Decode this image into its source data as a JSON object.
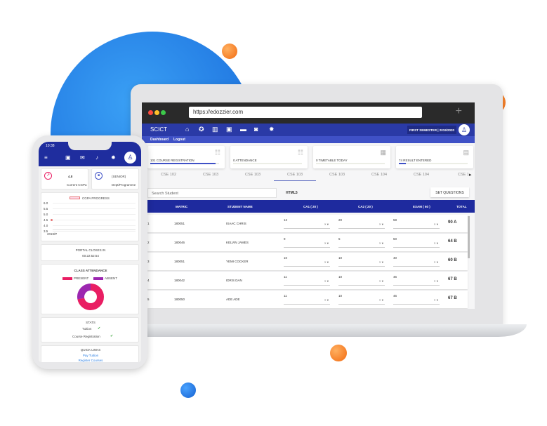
{
  "colors": {
    "primary": "#2a3aa6",
    "header": "#1e2a9e",
    "accent_orange": "#f26a10",
    "present": "#e91e63",
    "absent": "#9c27b0",
    "check": "#2e9e2e"
  },
  "laptop": {
    "browser": {
      "url": "https://edozzier.com"
    },
    "app": {
      "brand": "SCICT",
      "nav_icons": [
        "home-icon",
        "award-icon",
        "book-icon",
        "id-card-icon",
        "card-icon",
        "bus-icon",
        "gear-icon"
      ],
      "session": "FIRST SEMESTER | 2019/2020",
      "subnav": [
        "Dashboard",
        "Logout"
      ]
    },
    "cards": [
      {
        "label": "101 COURSE REGISTRATION",
        "progress": 0.95,
        "icon": "group-icon"
      },
      {
        "label": "0 ATTENDANCE",
        "progress": 0,
        "icon": "group-icon"
      },
      {
        "label": "0 TIMETABLE TODAY",
        "progress": 0,
        "icon": "table-icon"
      },
      {
        "label": "74 RESULT ENTERED",
        "progress": 0.1,
        "icon": "calculator-icon"
      }
    ],
    "tabs": [
      "CSE 102",
      "CSE 103",
      "CSE 103",
      "CSE 103",
      "CSE 103",
      "CSE 104",
      "CSE 104",
      "CSE 1"
    ],
    "active_tab": 3,
    "search_placeholder": "Search Student",
    "course_label": "HTML5",
    "set_questions": "SET QUESTIONS",
    "table": {
      "headers": [
        "MATRIC",
        "STUDENT NAME",
        "CA1 ( 20 )",
        "CA2 ( 20 )",
        "EXAM ( 60 )",
        "TOTAL"
      ],
      "rows": [
        {
          "n": "1",
          "matric": "180051",
          "name": "ISAAC CHRIS",
          "ca1": "12",
          "ca2": "20",
          "exam": "58",
          "total": "90 A"
        },
        {
          "n": "2",
          "matric": "180046",
          "name": "KELVIN JAMES",
          "ca1": "9",
          "ca2": "5",
          "exam": "50",
          "total": "64 B"
        },
        {
          "n": "3",
          "matric": "180051",
          "name": "YEMI COCKER",
          "ca1": "10",
          "ca2": "10",
          "exam": "40",
          "total": "60 B"
        },
        {
          "n": "4",
          "matric": "180042",
          "name": "IDRIS DAN",
          "ca1": "11",
          "ca2": "10",
          "exam": "46",
          "total": "67 B"
        },
        {
          "n": "5",
          "matric": "180050",
          "name": "ADE ADE",
          "ca1": "11",
          "ca2": "10",
          "exam": "46",
          "total": "67 B"
        }
      ]
    }
  },
  "phone": {
    "time": "10:38",
    "cgpa": {
      "value": "4.8",
      "label": "Current CGPa"
    },
    "dept": {
      "value": "(SENIOR)",
      "label": "Dept/Programme"
    },
    "chart": {
      "legend": "CGPA PROGRESS",
      "yticks": [
        "6.0",
        "5.5",
        "5.0",
        "4.5",
        "4.0",
        "3.5"
      ],
      "xtick": "2019/P",
      "point": 4.8
    },
    "portal": {
      "label": "PORTAL CLOSES IN",
      "countdown": "00:22:52:54"
    },
    "attendance": {
      "title": "CLASS ATTENDANCE",
      "present_label": "PRESENT",
      "absent_label": "ABSENT",
      "present": 72,
      "absent": 28
    },
    "stats": {
      "title": "STATS",
      "tuition": "Tuition",
      "course_registration": "Course Registration"
    },
    "quick_links": {
      "title": "QUICK LINKS",
      "links": [
        "Pay Tuition",
        "Register Courses"
      ]
    }
  }
}
